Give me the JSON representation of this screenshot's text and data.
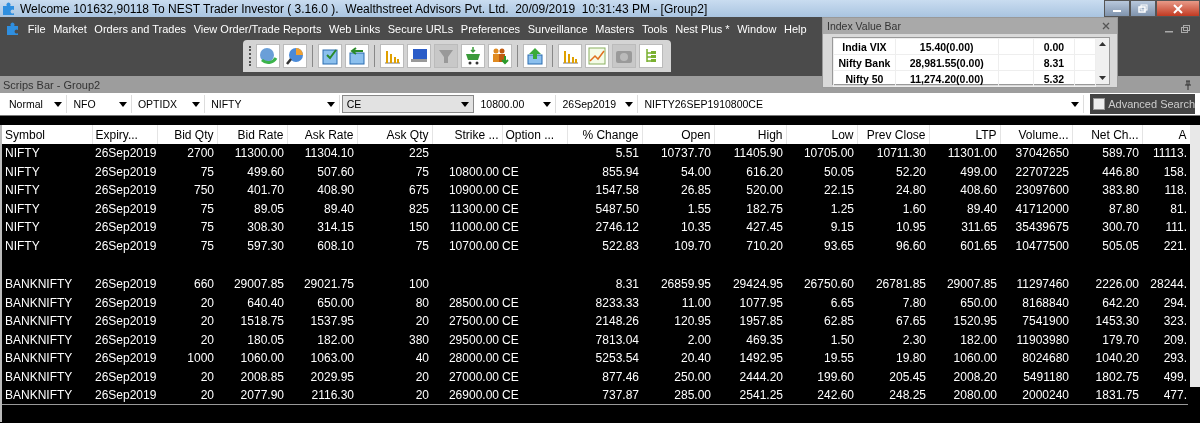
{
  "window": {
    "title": "Welcome 101632,90118 To NEST Trader Investor ( 3.16.0 ).  Wealthstreet Advisors Pvt. Ltd.  20/09/2019  10:31:43 PM - [Group2]"
  },
  "menu": [
    "File",
    "Market",
    "Orders and Trades",
    "View Order/Trade Reports",
    "Web Links",
    "Secure URLs",
    "Preferences",
    "Surveillance",
    "Masters",
    "Tools",
    "Nest Plus *",
    "Window",
    "Help"
  ],
  "index_value_bar": {
    "title": "Index Value Bar",
    "rows": [
      {
        "name": "India VIX",
        "value": "15.40(0.00)",
        "change": "0.00"
      },
      {
        "name": "Nifty Bank",
        "value": "28,981.55(0.00)",
        "change": "8.31"
      },
      {
        "name": "Nifty 50",
        "value": "11,274.20(0.00)",
        "change": "5.32"
      }
    ]
  },
  "scrips_bar": {
    "title": "Scrips Bar - Group2",
    "filters": [
      {
        "value": "Normal",
        "focused": false
      },
      {
        "value": "NFO",
        "focused": false
      },
      {
        "value": "OPTIDX",
        "focused": false
      },
      {
        "value": "NIFTY",
        "focused": false
      },
      {
        "value": "CE",
        "focused": true
      },
      {
        "value": "10800.00",
        "focused": false
      },
      {
        "value": "26Sep2019",
        "focused": false
      },
      {
        "value": "NIFTY26SEP1910800CE",
        "focused": false
      }
    ],
    "advanced_search": {
      "label": "Advanced Search",
      "checked": false
    }
  },
  "table": {
    "columns": [
      "Symbol",
      "Expiry...",
      "Bid Qty",
      "Bid Rate",
      "Ask Rate",
      "Ask Qty",
      "Strike ...",
      "Option ...",
      "% Change",
      "Open",
      "High",
      "Low",
      "Prev Close",
      "LTP",
      "Volume...",
      "Net Ch...",
      "A"
    ],
    "groups": [
      {
        "rows": [
          [
            "NIFTY",
            "26Sep2019",
            "2700",
            "11300.00",
            "11304.10",
            "225",
            "",
            "",
            "5.51",
            "10737.70",
            "11405.90",
            "10705.00",
            "10711.30",
            "11301.00",
            "37042650",
            "589.70",
            "11113."
          ],
          [
            "NIFTY",
            "26Sep2019",
            "75",
            "499.60",
            "507.60",
            "75",
            "10800.00",
            "CE",
            "855.94",
            "54.00",
            "616.20",
            "50.05",
            "52.20",
            "499.00",
            "22707225",
            "446.80",
            "158."
          ],
          [
            "NIFTY",
            "26Sep2019",
            "750",
            "401.70",
            "408.90",
            "675",
            "10900.00",
            "CE",
            "1547.58",
            "26.85",
            "520.00",
            "22.15",
            "24.80",
            "408.60",
            "23097600",
            "383.80",
            "118."
          ],
          [
            "NIFTY",
            "26Sep2019",
            "75",
            "89.05",
            "89.40",
            "825",
            "11300.00",
            "CE",
            "5487.50",
            "1.55",
            "182.75",
            "1.25",
            "1.60",
            "89.40",
            "41712000",
            "87.80",
            "81."
          ],
          [
            "NIFTY",
            "26Sep2019",
            "75",
            "308.30",
            "314.15",
            "150",
            "11000.00",
            "CE",
            "2746.12",
            "10.35",
            "427.45",
            "9.15",
            "10.95",
            "311.65",
            "35439675",
            "300.70",
            "111."
          ],
          [
            "NIFTY",
            "26Sep2019",
            "75",
            "597.30",
            "608.10",
            "75",
            "10700.00",
            "CE",
            "522.83",
            "109.70",
            "710.20",
            "93.65",
            "96.60",
            "601.65",
            "10477500",
            "505.05",
            "221."
          ]
        ]
      },
      {
        "rows": [
          [
            "BANKNIFTY",
            "26Sep2019",
            "660",
            "29007.85",
            "29021.75",
            "100",
            "",
            "",
            "8.31",
            "26859.95",
            "29424.95",
            "26750.60",
            "26781.85",
            "29007.85",
            "11297460",
            "2226.00",
            "28244."
          ],
          [
            "BANKNIFTY",
            "26Sep2019",
            "20",
            "640.40",
            "650.00",
            "80",
            "28500.00",
            "CE",
            "8233.33",
            "11.00",
            "1077.95",
            "6.65",
            "7.80",
            "650.00",
            "8168840",
            "642.20",
            "294."
          ],
          [
            "BANKNIFTY",
            "26Sep2019",
            "20",
            "1518.75",
            "1537.95",
            "20",
            "27500.00",
            "CE",
            "2148.26",
            "120.95",
            "1957.85",
            "62.85",
            "67.65",
            "1520.95",
            "7541900",
            "1453.30",
            "323."
          ],
          [
            "BANKNIFTY",
            "26Sep2019",
            "20",
            "180.05",
            "182.00",
            "380",
            "29500.00",
            "CE",
            "7813.04",
            "2.00",
            "469.35",
            "1.50",
            "2.30",
            "182.00",
            "11903980",
            "179.70",
            "209."
          ],
          [
            "BANKNIFTY",
            "26Sep2019",
            "1000",
            "1060.00",
            "1063.00",
            "40",
            "28000.00",
            "CE",
            "5253.54",
            "20.40",
            "1492.95",
            "19.55",
            "19.80",
            "1060.00",
            "8024680",
            "1040.20",
            "293."
          ],
          [
            "BANKNIFTY",
            "26Sep2019",
            "20",
            "2008.85",
            "2029.95",
            "20",
            "27000.00",
            "CE",
            "877.46",
            "250.00",
            "2444.20",
            "199.60",
            "205.45",
            "2008.20",
            "5491180",
            "1802.75",
            "499."
          ],
          [
            "BANKNIFTY",
            "26Sep2019",
            "20",
            "2077.90",
            "2116.30",
            "20",
            "26900.00",
            "CE",
            "737.87",
            "285.00",
            "2541.25",
            "242.60",
            "248.25",
            "2080.00",
            "2000240",
            "1831.75",
            "477."
          ]
        ]
      }
    ]
  }
}
